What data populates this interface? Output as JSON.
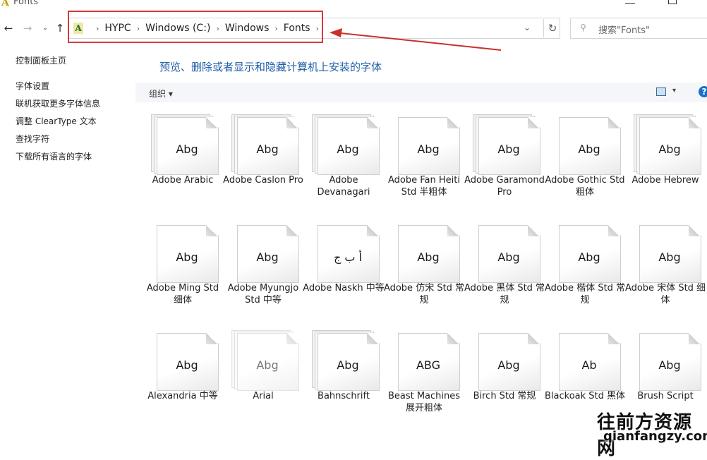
{
  "window": {
    "title": "Fonts"
  },
  "address": {
    "crumbs": [
      "HYPC",
      "Windows (C:)",
      "Windows",
      "Fonts"
    ],
    "search_placeholder": "搜索\"Fonts\""
  },
  "sidebar": {
    "home": "控制面板主页",
    "links": [
      "字体设置",
      "联机获取更多字体信息",
      "调整 ClearType 文本",
      "查找字符",
      "下载所有语言的字体"
    ]
  },
  "main": {
    "heading": "预览、删除或者显示和隐藏计算机上安装的字体",
    "organize_label": "组织 ▾",
    "help_label": "?"
  },
  "fonts": [
    {
      "name": "Adobe Arabic",
      "preview": "Abg",
      "stacked": true
    },
    {
      "name": "Adobe Caslon Pro",
      "preview": "Abg",
      "stacked": true
    },
    {
      "name": "Adobe Devanagari",
      "preview": "Abg",
      "stacked": true
    },
    {
      "name": "Adobe Fan Heiti Std 半粗体",
      "preview": "Abg",
      "stacked": false
    },
    {
      "name": "Adobe Garamond Pro",
      "preview": "Abg",
      "stacked": true
    },
    {
      "name": "Adobe Gothic Std 粗体",
      "preview": "Abg",
      "stacked": false
    },
    {
      "name": "Adobe Hebrew",
      "preview": "Abg",
      "stacked": true
    },
    {
      "name": "Adobe Ming Std 细体",
      "preview": "Abg",
      "stacked": false
    },
    {
      "name": "Adobe Myungjo Std 中等",
      "preview": "Abg",
      "stacked": false
    },
    {
      "name": "Adobe Naskh 中等",
      "preview": "أ ب ج",
      "stacked": false
    },
    {
      "name": "Adobe 仿宋 Std 常规",
      "preview": "Abg",
      "stacked": false
    },
    {
      "name": "Adobe 黑体 Std 常规",
      "preview": "Abg",
      "stacked": false
    },
    {
      "name": "Adobe 楷体 Std 常规",
      "preview": "Abg",
      "stacked": false
    },
    {
      "name": "Adobe 宋体 Std 细体",
      "preview": "Abg",
      "stacked": false
    },
    {
      "name": "Alexandria 中等",
      "preview": "Abg",
      "stacked": false
    },
    {
      "name": "Arial",
      "preview": "Abg",
      "stacked": true
    },
    {
      "name": "Bahnschrift",
      "preview": "Abg",
      "stacked": true
    },
    {
      "name": "Beast Machines 展开粗体",
      "preview": "ABG",
      "stacked": false
    },
    {
      "name": "Birch Std 常规",
      "preview": "Abg",
      "stacked": false
    },
    {
      "name": "Blackoak Std 黑体",
      "preview": "Ab",
      "stacked": false
    },
    {
      "name": "Brush Script",
      "preview": "Abg",
      "stacked": false
    }
  ],
  "watermark": {
    "cn": "往前方资源网",
    "url": "qianfangzy.com"
  }
}
